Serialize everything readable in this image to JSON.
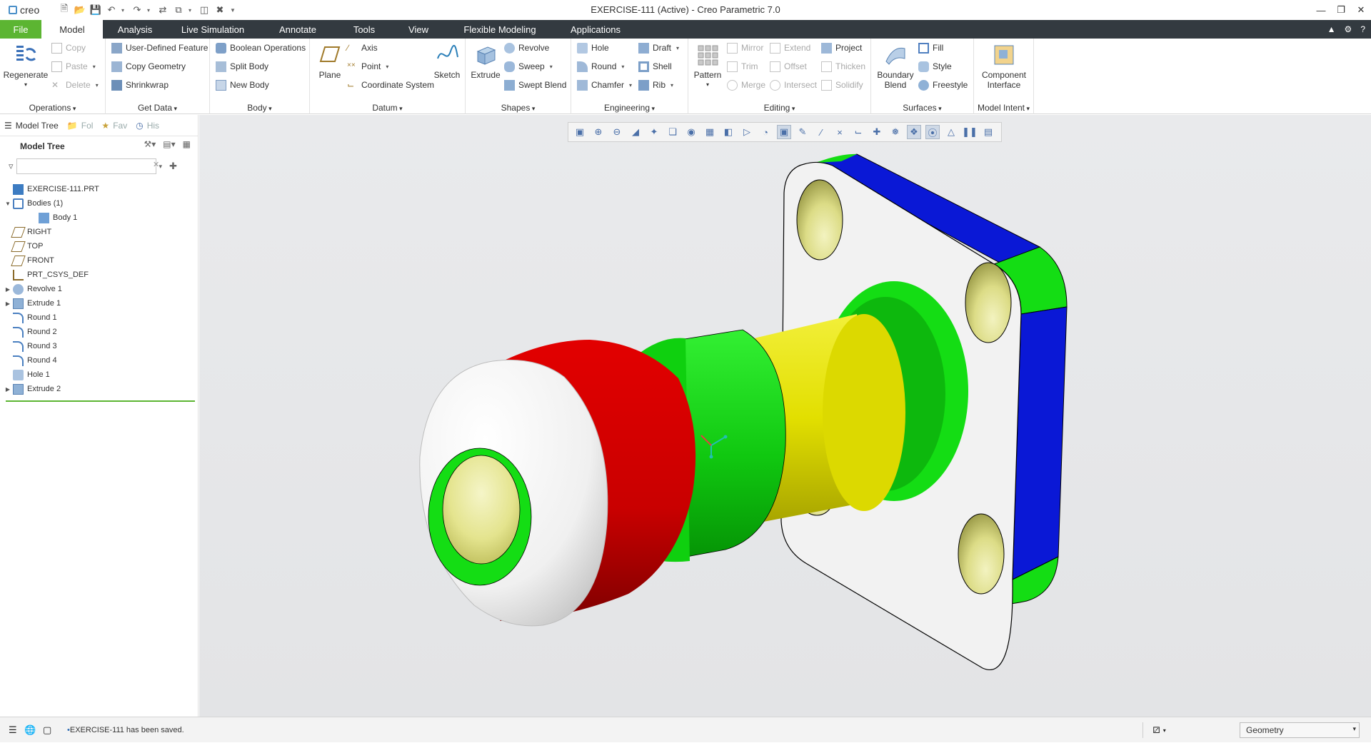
{
  "app": {
    "brand": "creo",
    "window_title": "EXERCISE-111 (Active) - Creo Parametric 7.0"
  },
  "colors": {
    "tab_bar_bg": "#333a40",
    "file_tab_bg": "#5cb532",
    "model_white": "#f2f2f2",
    "model_red": "#d90000",
    "model_green": "#14dd14",
    "model_yellow": "#e4e100",
    "model_blue": "#0a18d6",
    "hole_interior": "#e9e9a0"
  },
  "tabs": [
    "File",
    "Model",
    "Analysis",
    "Live Simulation",
    "Annotate",
    "Tools",
    "View",
    "Flexible Modeling",
    "Applications"
  ],
  "active_tab": "Model",
  "ribbon": {
    "operations": {
      "label": "Operations",
      "regenerate": "Regenerate",
      "copy": "Copy",
      "paste": "Paste",
      "delete": "Delete"
    },
    "get_data": {
      "label": "Get Data",
      "user_defined_feature": "User-Defined Feature",
      "copy_geometry": "Copy Geometry",
      "shrinkwrap": "Shrinkwrap"
    },
    "body": {
      "label": "Body",
      "boolean_operations": "Boolean Operations",
      "split_body": "Split Body",
      "new_body": "New Body"
    },
    "datum": {
      "label": "Datum",
      "plane": "Plane",
      "axis": "Axis",
      "point": "Point",
      "coordinate_system": "Coordinate System",
      "sketch": "Sketch"
    },
    "shapes": {
      "label": "Shapes",
      "extrude": "Extrude",
      "revolve": "Revolve",
      "sweep": "Sweep",
      "swept_blend": "Swept Blend"
    },
    "engineering": {
      "label": "Engineering",
      "hole": "Hole",
      "round": "Round",
      "chamfer": "Chamfer",
      "draft": "Draft",
      "shell": "Shell",
      "rib": "Rib"
    },
    "editing": {
      "label": "Editing",
      "pattern": "Pattern",
      "mirror": "Mirror",
      "trim": "Trim",
      "merge": "Merge",
      "extend": "Extend",
      "offset": "Offset",
      "intersect": "Intersect",
      "project": "Project",
      "thicken": "Thicken",
      "solidify": "Solidify"
    },
    "surfaces": {
      "label": "Surfaces",
      "boundary_blend_1": "Boundary",
      "boundary_blend_2": "Blend",
      "fill": "Fill",
      "style": "Style",
      "freestyle": "Freestyle"
    },
    "model_intent": {
      "label": "Model Intent",
      "component_interface_1": "Component",
      "component_interface_2": "Interface"
    }
  },
  "panel": {
    "tabs": [
      "Model Tree",
      "Fol",
      "Fav",
      "His"
    ],
    "header": "Model Tree",
    "search_value": "",
    "tree": [
      {
        "label": "EXERCISE-111.PRT",
        "icon": "part-icon",
        "expander": "",
        "indent": 0
      },
      {
        "label": "Bodies (1)",
        "icon": "bodies-icon",
        "expander": "open",
        "indent": 1
      },
      {
        "label": "Body 1",
        "icon": "body-icon",
        "expander": "",
        "indent": 2
      },
      {
        "label": "RIGHT",
        "icon": "datum-plane-icon",
        "expander": "",
        "indent": 1
      },
      {
        "label": "TOP",
        "icon": "datum-plane-icon",
        "expander": "",
        "indent": 1
      },
      {
        "label": "FRONT",
        "icon": "datum-plane-icon",
        "expander": "",
        "indent": 1
      },
      {
        "label": "PRT_CSYS_DEF",
        "icon": "csys-icon",
        "expander": "",
        "indent": 1
      },
      {
        "label": "Revolve 1",
        "icon": "revolve-icon",
        "expander": "closed",
        "indent": 1
      },
      {
        "label": "Extrude 1",
        "icon": "extrude-icon",
        "expander": "closed",
        "indent": 1
      },
      {
        "label": "Round 1",
        "icon": "round-icon",
        "expander": "",
        "indent": 1
      },
      {
        "label": "Round 2",
        "icon": "round-icon",
        "expander": "",
        "indent": 1
      },
      {
        "label": "Round 3",
        "icon": "round-icon",
        "expander": "",
        "indent": 1
      },
      {
        "label": "Round 4",
        "icon": "round-icon",
        "expander": "",
        "indent": 1
      },
      {
        "label": "Hole 1",
        "icon": "hole-icon",
        "expander": "",
        "indent": 1
      },
      {
        "label": "Extrude 2",
        "icon": "extrude-icon",
        "expander": "closed",
        "indent": 1
      }
    ]
  },
  "status": {
    "message": "EXERCISE-111 has been saved.",
    "filter_value": "Geometry"
  }
}
